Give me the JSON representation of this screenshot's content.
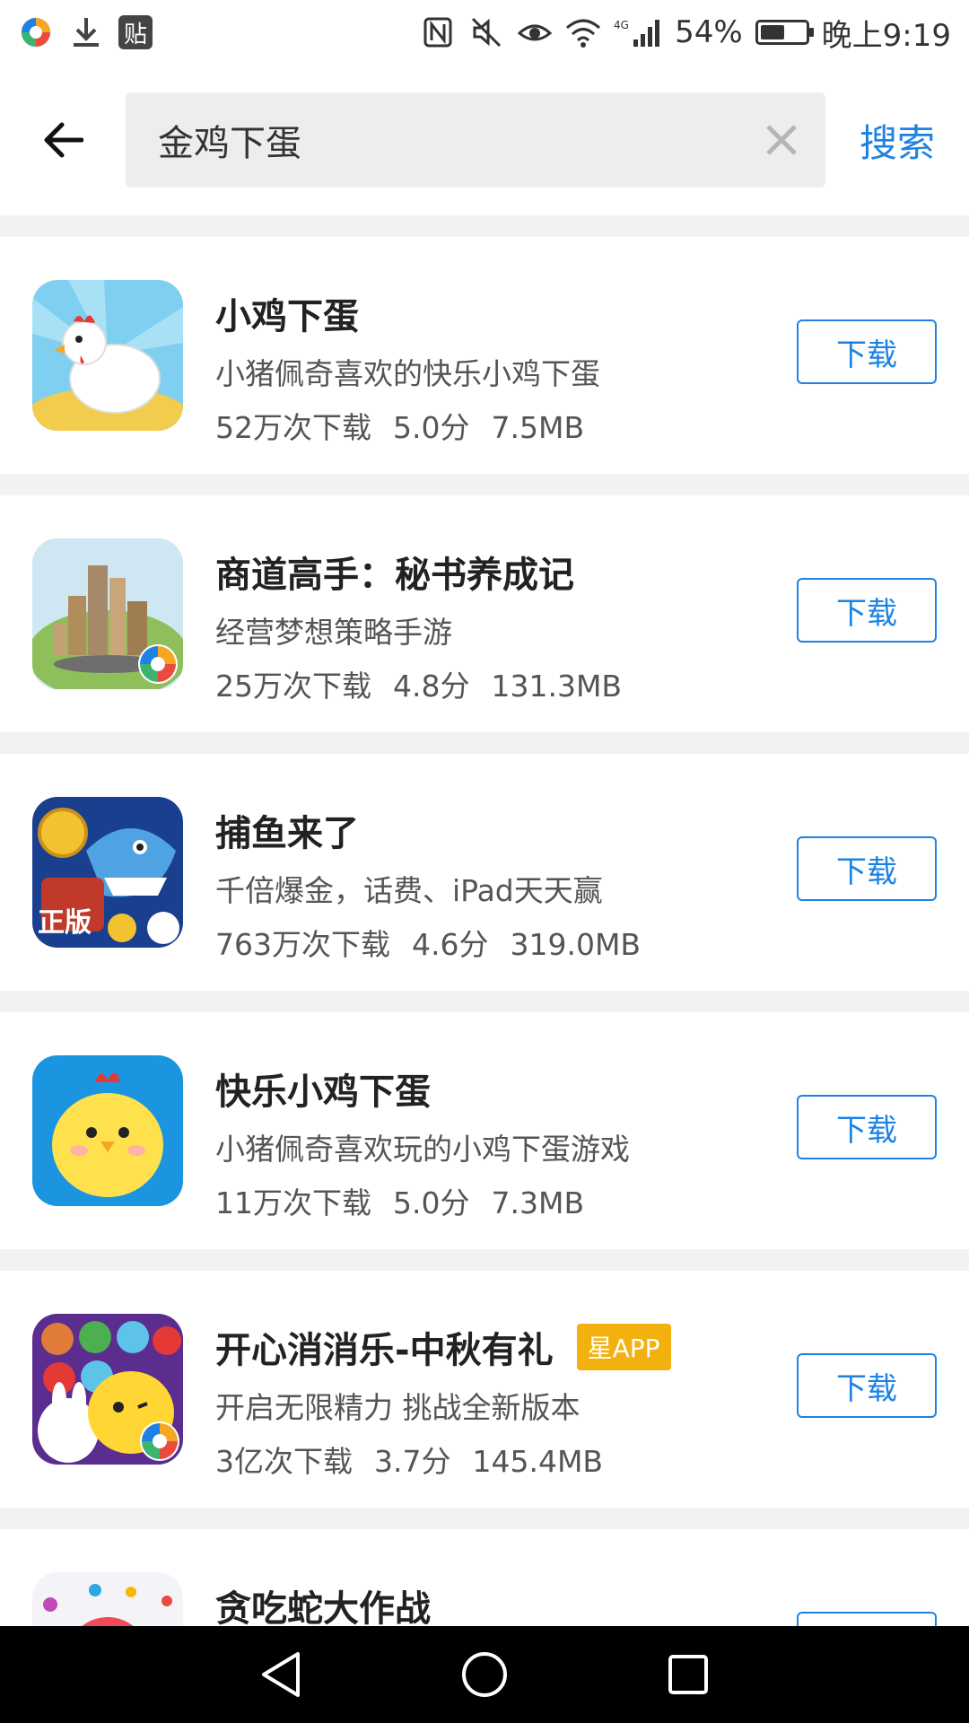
{
  "status_bar": {
    "badge_text": "贴",
    "battery": "54%",
    "battery_level": 0.54,
    "time": "晚上9:19",
    "network": "4G"
  },
  "search": {
    "query": "金鸡下蛋",
    "search_label": "搜索"
  },
  "apps": [
    {
      "name": "小鸡下蛋",
      "desc": "小猪佩奇喜欢的快乐小鸡下蛋",
      "downloads": "52万次下载",
      "rating": "5.0分",
      "size": "7.5MB",
      "button": "下载"
    },
    {
      "name": "商道高手：秘书养成记",
      "desc": "经营梦想策略手游",
      "downloads": "25万次下载",
      "rating": "4.8分",
      "size": "131.3MB",
      "button": "下载"
    },
    {
      "name": "捕鱼来了",
      "desc": "千倍爆金，话费、iPad天天赢",
      "downloads": "763万次下载",
      "rating": "4.6分",
      "size": "319.0MB",
      "button": "下载",
      "icon_label": "正版"
    },
    {
      "name": "快乐小鸡下蛋",
      "desc": "小猪佩奇喜欢玩的小鸡下蛋游戏",
      "downloads": "11万次下载",
      "rating": "5.0分",
      "size": "7.3MB",
      "button": "下载"
    },
    {
      "name": "开心消消乐-中秋有礼",
      "badge": "星APP",
      "desc": "开启无限精力 挑战全新版本",
      "downloads": "3亿次下载",
      "rating": "3.7分",
      "size": "145.4MB",
      "button": "下载"
    },
    {
      "name": "贪吃蛇大作战"
    }
  ],
  "colors": {
    "accent": "#1d82e4",
    "badge": "#f2b10f",
    "background": "#f2f2f2"
  }
}
